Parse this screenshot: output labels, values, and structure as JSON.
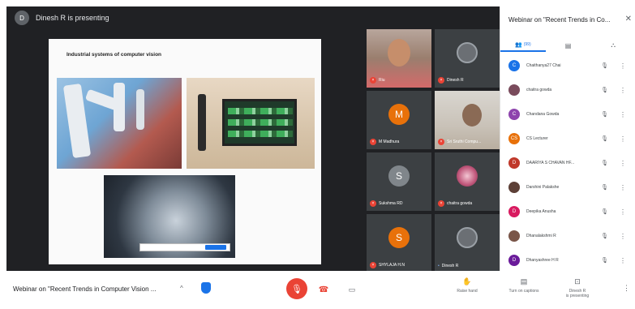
{
  "presenter": {
    "initial": "D",
    "text": "Dinesh R is presenting"
  },
  "slide": {
    "title": "Industrial systems of computer vision"
  },
  "tiles": [
    {
      "name": "Riu",
      "initial": ""
    },
    {
      "name": "Dinesh R",
      "initial": ""
    },
    {
      "name": "M Madhura",
      "initial": "M",
      "color": "#e8710a"
    },
    {
      "name": "Sri Sruthi Compu...",
      "initial": ""
    },
    {
      "name": "Sukshma RD",
      "initial": "S",
      "color": "#5f6368"
    },
    {
      "name": "chaitra gowda",
      "initial": ""
    },
    {
      "name": "SHYLAJA H.N",
      "initial": "S",
      "color": "#e8710a"
    },
    {
      "name": "Dinesh R",
      "initial": ""
    }
  ],
  "panel": {
    "title": "Webinar on \"Recent Trends in Co...",
    "tabs": {
      "people": "(99)",
      "chat": "",
      "activities": ""
    },
    "participants": [
      {
        "initial": "C",
        "name": "Chaithanya27 Chai",
        "color": "#1a73e8"
      },
      {
        "initial": "",
        "name": "chaitra gowda",
        "color": "#7a4b5c"
      },
      {
        "initial": "C",
        "name": "Chandana Gowda",
        "color": "#8e44ad"
      },
      {
        "initial": "CS",
        "name": "CS Lecturer",
        "color": "#e8710a"
      },
      {
        "initial": "D",
        "name": "DAARIYA S CHAVAN HF...",
        "color": "#c0392b"
      },
      {
        "initial": "",
        "name": "Darshini Palakshe",
        "color": "#5d4037"
      },
      {
        "initial": "D",
        "name": "Deepika Anusha",
        "color": "#d81b60"
      },
      {
        "initial": "",
        "name": "Dhanalakshmi R",
        "color": "#795548"
      },
      {
        "initial": "D",
        "name": "Dhanyashree H R",
        "color": "#6a1b9a"
      }
    ]
  },
  "bottom": {
    "meeting_title": "Webinar on \"Recent Trends in Computer Vision ...",
    "raise_hand": "Raise hand",
    "captions": "Turn on captions",
    "presenting": "Dinesh R\nis presenting"
  },
  "icons": {
    "mic_off": "mic-off-icon",
    "hang_up": "call-end-icon",
    "camera": "camera-icon",
    "shield": "shield-icon",
    "more": "more-vert-icon"
  }
}
